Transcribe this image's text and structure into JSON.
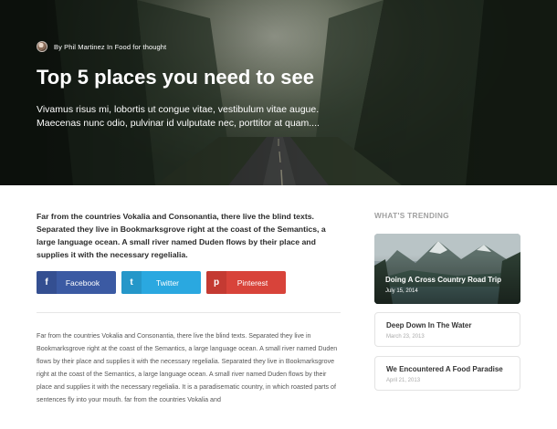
{
  "hero": {
    "byline": "By Phil Martinez In Food for thought",
    "title": "Top 5 places you need to see",
    "subtitle": "Vivamus risus mi, lobortis ut congue vitae, vestibulum vitae augue. Maecenas nunc odio, pulvinar id vulputate nec, porttitor at quam...."
  },
  "intro": "Far from the countries Vokalia and Consonantia, there live the blind texts. Separated they live in Bookmarksgrove right at the coast of the Semantics, a large language ocean. A small river named Duden flows by their place and supplies it with the necessary regelialia.",
  "share": {
    "facebook": {
      "label": "Facebook",
      "icon": "f"
    },
    "twitter": {
      "label": "Twitter",
      "icon": "t"
    },
    "pinterest": {
      "label": "Pinterest",
      "icon": "p"
    },
    "colors": {
      "facebook": "#3b5aa3",
      "twitter": "#2aa8e0",
      "pinterest": "#d8433a"
    }
  },
  "body": "Far from the countries Vokalia and Consonantia, there live the blind texts. Separated they live in Bookmarksgrove right at the coast of the Semantics, a large language ocean. A small river named Duden flows by their place and supplies it with the necessary regelialia. Separated they live in Bookmarksgrove right at the coast of the Semantics, a large language ocean. A small river named Duden flows by their place and supplies it with the necessary regelialia. It is a paradisematic country, in which roasted parts of sentences fly into your mouth. far from the countries Vokalia and",
  "sidebar": {
    "heading": "WHAT'S TRENDING",
    "featured": {
      "title": "Doing A Cross Country Road Trip",
      "date": "July 15, 2014"
    },
    "items": [
      {
        "title": "Deep Down In The Water",
        "date": "March 23, 2013"
      },
      {
        "title": "We Encountered A Food Paradise",
        "date": "April 21, 2013"
      }
    ]
  }
}
